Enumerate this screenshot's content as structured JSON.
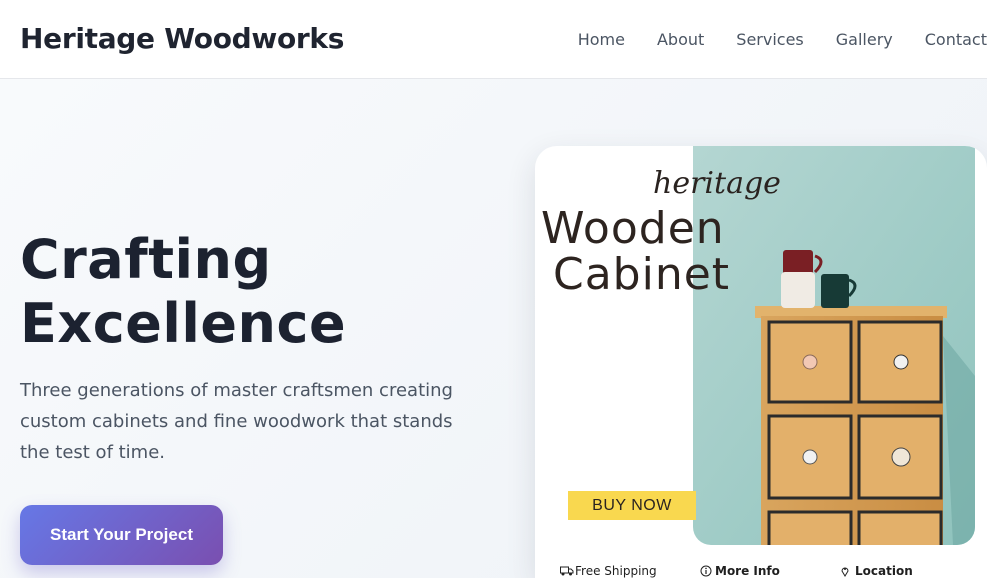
{
  "header": {
    "brand": "Heritage Woodworks",
    "nav": [
      "Home",
      "About",
      "Services",
      "Gallery",
      "Contact"
    ]
  },
  "hero": {
    "title_line1": "Crafting",
    "title_line2": "Excellence",
    "subtitle": "Three generations of master craftsmen creating custom cabinets and fine woodwork that stands the test of time.",
    "cta": "Start Your Project"
  },
  "promo_card": {
    "script_word": "heritage",
    "title_line1": "Wooden",
    "title_line2": "Cabinet",
    "buy_label": "BUY NOW",
    "info": [
      "Free Shipping",
      "More Info",
      "Location"
    ],
    "icons": [
      "truck-icon",
      "info-icon",
      "location-pin-icon"
    ]
  },
  "colors": {
    "cta_start": "#6678e6",
    "cta_end": "#7a4fb0",
    "buy_bg": "#f9d84f",
    "photo_wall": "#a8cfcb"
  }
}
